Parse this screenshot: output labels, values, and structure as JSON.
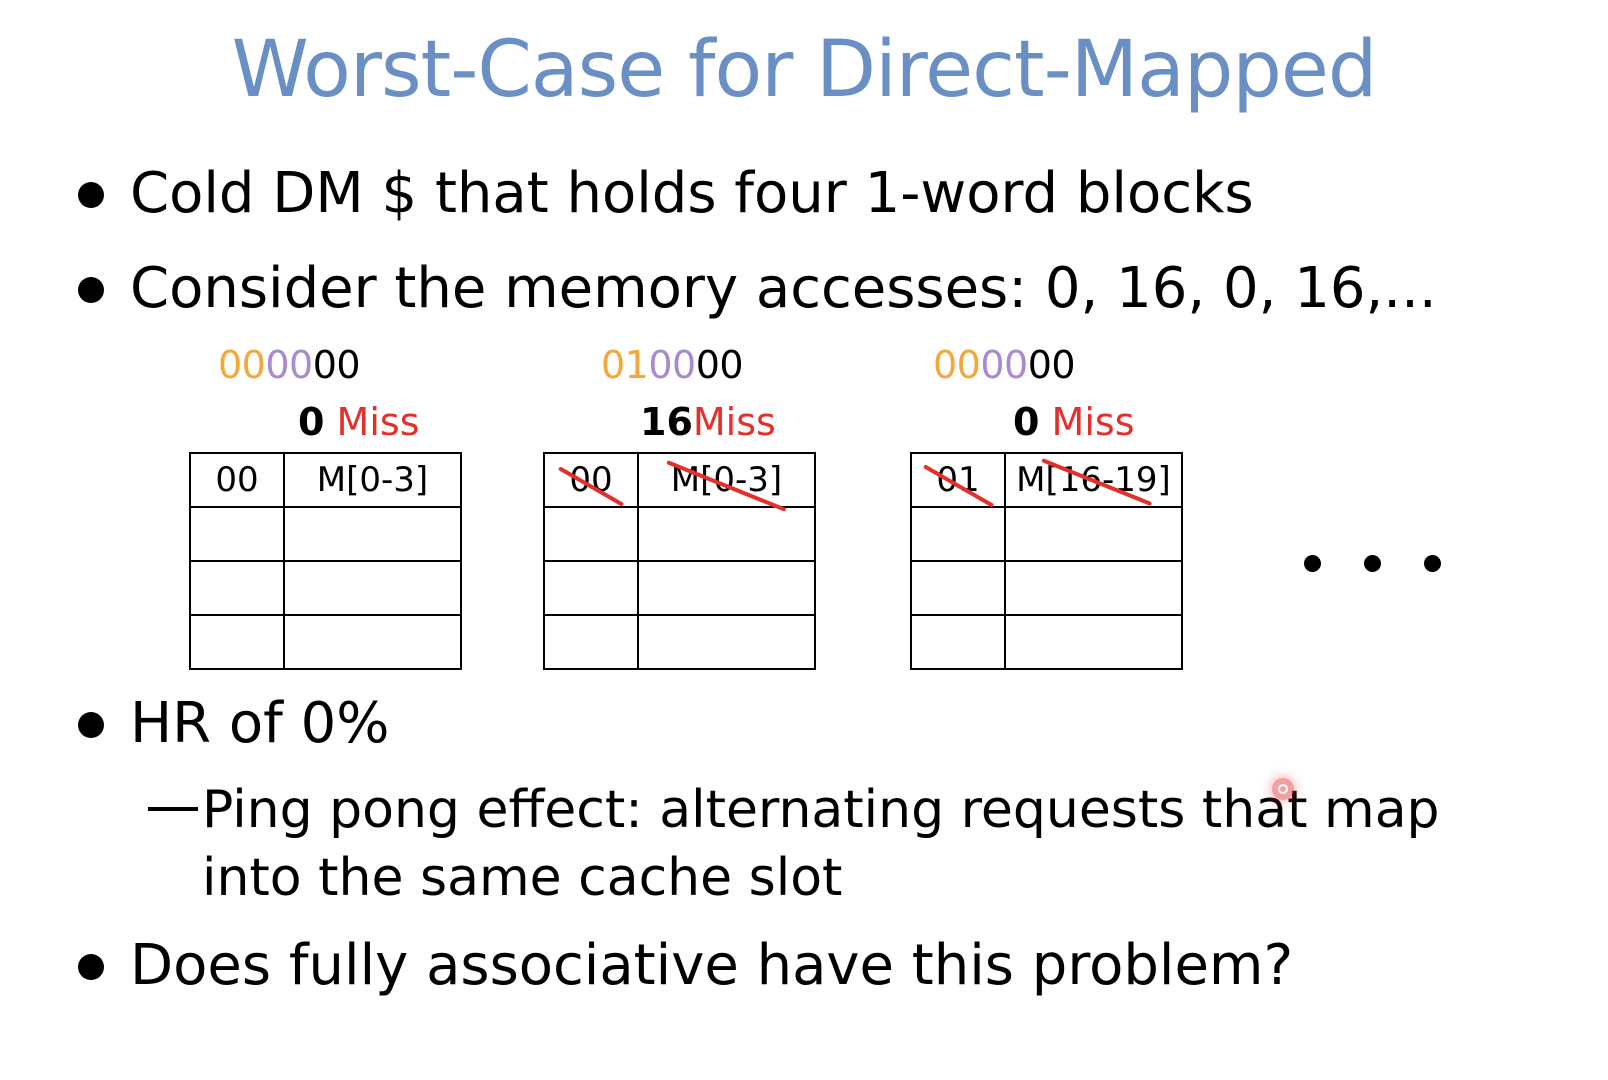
{
  "title": "Worst-Case for Direct-Mapped",
  "colors": {
    "title": "#6a8fc5",
    "tag_bits": "#f2a83a",
    "index_bits": "#a98ad0",
    "offset_bits": "#000000",
    "miss": "#e2302a",
    "strike": "#e2302a"
  },
  "bullets": [
    {
      "text": "Cold DM $ that holds four 1-word blocks"
    },
    {
      "text": "Consider the memory accesses:  0, 16, 0, 16,..."
    },
    {
      "text": "HR of 0%",
      "sub": [
        "Ping pong effect:  alternating requests that map",
        "into the same cache slot"
      ]
    },
    {
      "text": "Does fully associative have this problem?"
    }
  ],
  "accesses": [
    {
      "address": {
        "tag": "00",
        "index": "00",
        "offset": "00"
      },
      "value": "0",
      "result": "Miss",
      "cache_rows": [
        {
          "tag": "00",
          "data": "M[0-3]",
          "struck": false
        },
        {
          "tag": "",
          "data": ""
        },
        {
          "tag": "",
          "data": ""
        },
        {
          "tag": "",
          "data": ""
        }
      ]
    },
    {
      "address": {
        "tag": "01",
        "index": "00",
        "offset": "00"
      },
      "value": "16",
      "result": "Miss",
      "cache_rows": [
        {
          "tag": "00",
          "data": "M[0-3]",
          "struck": true
        },
        {
          "tag": "",
          "data": ""
        },
        {
          "tag": "",
          "data": ""
        },
        {
          "tag": "",
          "data": ""
        }
      ]
    },
    {
      "address": {
        "tag": "00",
        "index": "00",
        "offset": "00"
      },
      "value": "0",
      "result": "Miss",
      "cache_rows": [
        {
          "tag": "01",
          "data": "M[16-19]",
          "struck": true
        },
        {
          "tag": "",
          "data": ""
        },
        {
          "tag": "",
          "data": ""
        },
        {
          "tag": "",
          "data": ""
        }
      ]
    }
  ],
  "continuation": "ellipsis-icon"
}
